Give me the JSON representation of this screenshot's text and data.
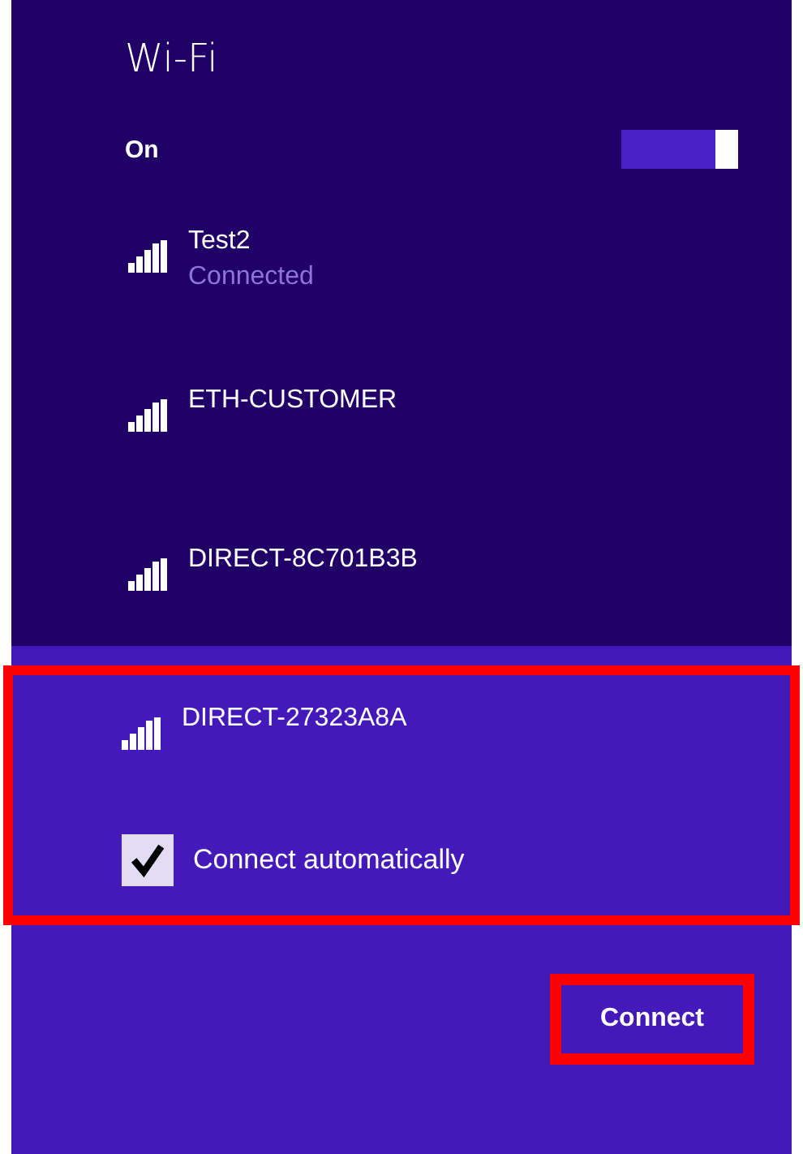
{
  "title": "Wi-Fi",
  "wifi_toggle": {
    "label": "On",
    "on": true
  },
  "networks": [
    {
      "name": "Test2",
      "status": "Connected",
      "selected": false,
      "highlighted": false
    },
    {
      "name": "ETH-CUSTOMER",
      "selected": false,
      "highlighted": false
    },
    {
      "name": "DIRECT-8C701B3B",
      "selected": false,
      "highlighted": false
    },
    {
      "name": "DIRECT-27323A8A",
      "selected": true,
      "highlighted": true,
      "connect_automatically": {
        "label": "Connect automatically",
        "checked": true
      }
    }
  ],
  "connect_button": {
    "label": "Connect",
    "highlighted": true
  }
}
